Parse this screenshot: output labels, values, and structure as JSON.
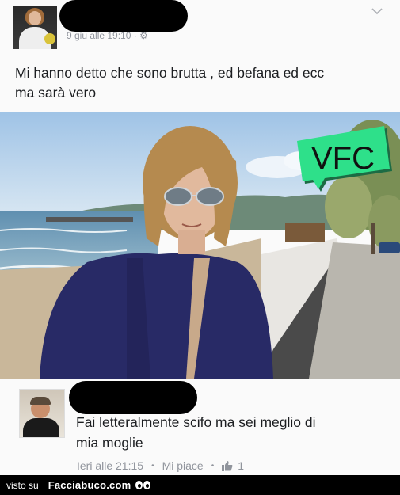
{
  "post": {
    "timestamp": "9 giu alle 19:10 · ⚙",
    "text_line1": "Mi hanno detto che sono brutta , ed befana  ed ecc",
    "text_line2": "ma sarà  vero"
  },
  "photo": {
    "watermark": "VFC",
    "watermark_color": "#22dd88"
  },
  "comment": {
    "text_line1": "Fai letteralmente scifo ma sei meglio di",
    "text_line2": "mia moglie",
    "time": "Ieri alle 21:15",
    "like_label": "Mi piace",
    "like_count": "1"
  },
  "footer": {
    "visto_label": "visto su",
    "brand": "Facciabuco.com"
  }
}
